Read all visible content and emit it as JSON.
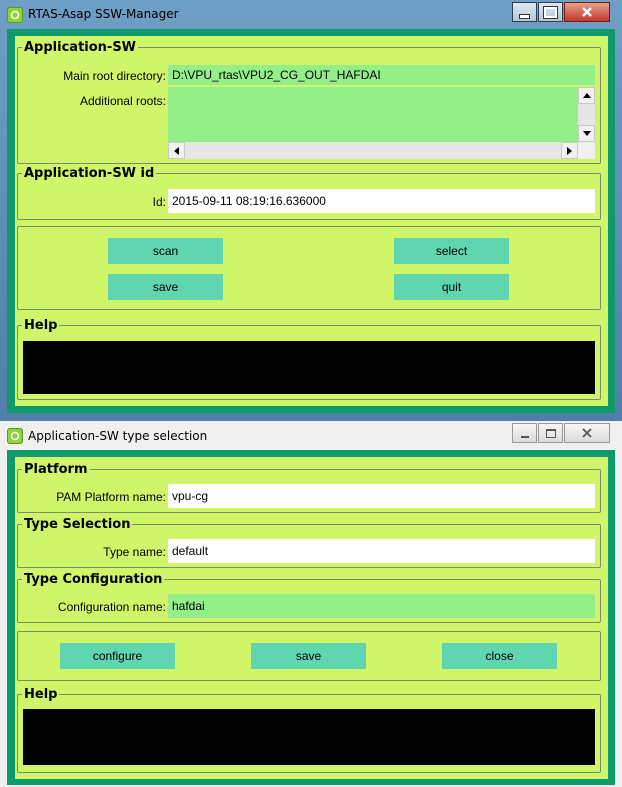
{
  "window1": {
    "title": "RTAS-Asap SSW-Manager",
    "app_sw_group": {
      "legend": "Application-SW",
      "main_root_label": "Main root directory:",
      "main_root_value": "D:\\VPU_rtas\\VPU2_CG_OUT_HAFDAI",
      "additional_roots_label": "Additional roots:",
      "additional_roots_value": ""
    },
    "app_sw_id_group": {
      "legend": "Application-SW id",
      "id_label": "Id:",
      "id_value": "2015-09-11 08:19:16.636000"
    },
    "buttons": {
      "scan": "scan",
      "select": "select",
      "save": "save",
      "quit": "quit"
    },
    "help_group": {
      "legend": "Help"
    }
  },
  "window2": {
    "title": "Application-SW type selection",
    "platform_group": {
      "legend": "Platform",
      "pam_label": "PAM Platform name:",
      "pam_value": "vpu-cg"
    },
    "type_selection_group": {
      "legend": "Type Selection",
      "type_label": "Type name:",
      "type_value": "default"
    },
    "type_config_group": {
      "legend": "Type Configuration",
      "config_label": "Configuration name:",
      "config_value": "hafdai"
    },
    "buttons": {
      "configure": "configure",
      "save": "save",
      "close": "close"
    },
    "help_group": {
      "legend": "Help"
    }
  },
  "icons": {
    "app": "app-icon",
    "minimize": "minimize-icon",
    "maximize": "maximize-icon",
    "close": "close-icon",
    "scroll_up": "arrow-up-icon",
    "scroll_down": "arrow-down-icon",
    "scroll_left": "arrow-left-icon",
    "scroll_right": "arrow-right-icon"
  },
  "colors": {
    "panel_bg": "#d1f56a",
    "outer_border": "#0f9a6e",
    "readonly_field": "#94ee8a",
    "editable_field": "#ffffff",
    "button": "#5fd6b0",
    "help_bg": "#000000"
  }
}
